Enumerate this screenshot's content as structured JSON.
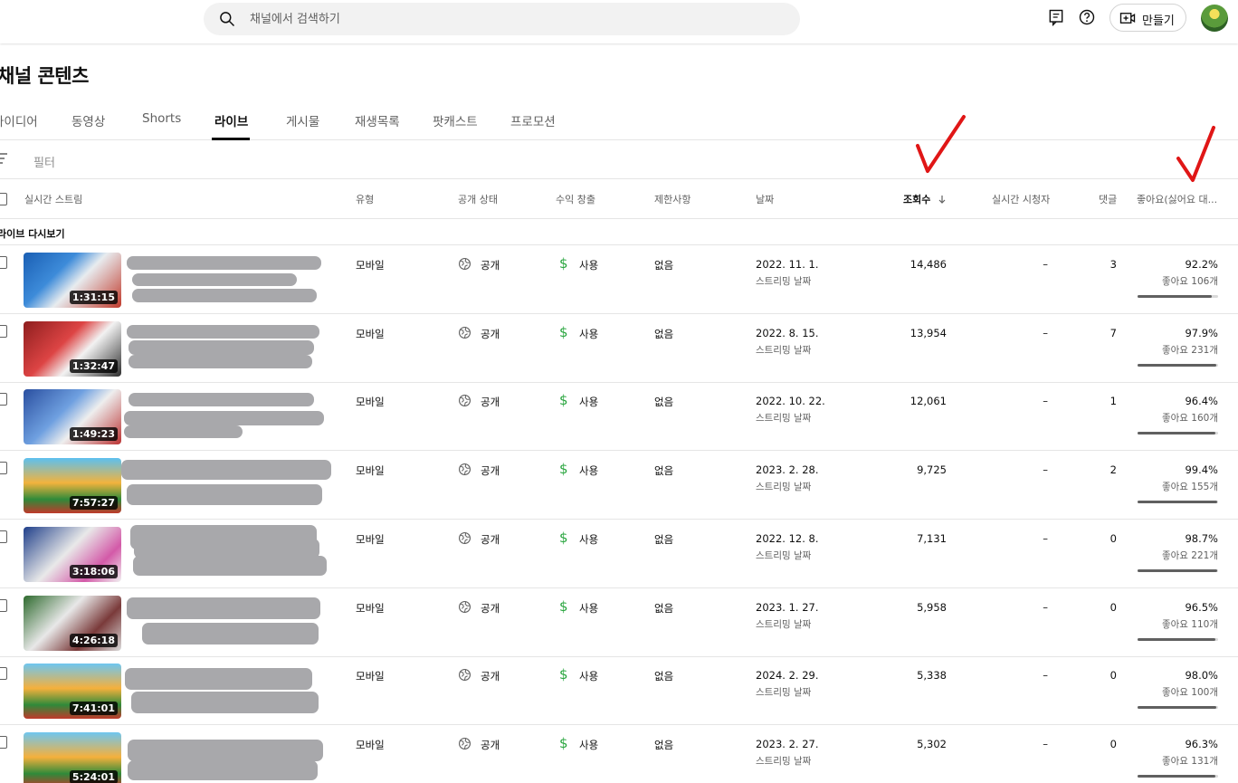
{
  "search": {
    "placeholder": "채널에서 검색하기"
  },
  "topbar": {
    "create_label": "만들기"
  },
  "page_title": "채널 콘텐츠",
  "tabs": [
    {
      "label": "아이디어",
      "active": false
    },
    {
      "label": "동영상",
      "active": false
    },
    {
      "label": "Shorts",
      "active": false
    },
    {
      "label": "라이브",
      "active": true
    },
    {
      "label": "게시물",
      "active": false
    },
    {
      "label": "재생목록",
      "active": false
    },
    {
      "label": "팟캐스트",
      "active": false
    },
    {
      "label": "프로모션",
      "active": false
    }
  ],
  "filter": {
    "label": "필터"
  },
  "columns": {
    "stream": "실시간 스트림",
    "type": "유형",
    "visibility": "공개 상태",
    "monetization": "수익 창출",
    "restrictions": "제한사항",
    "date": "날짜",
    "views": "조회수",
    "live_viewers": "실시간 시청자",
    "comments": "댓글",
    "likes": "좋아요(싫어요 대..."
  },
  "section": {
    "label": "라이브 다시보기"
  },
  "rows": [
    {
      "duration": "1:31:15",
      "type": "모바일",
      "visibility": "공개",
      "monetization": "사용",
      "restrictions": "없음",
      "date": "2022. 11. 1.",
      "date_sub": "스트리밍 날짜",
      "views": "14,486",
      "live_viewers": "–",
      "comments": "3",
      "like_pct": "92.2%",
      "like_count": "좋아요 106개",
      "like_ratio": 0.922
    },
    {
      "duration": "1:32:47",
      "type": "모바일",
      "visibility": "공개",
      "monetization": "사용",
      "restrictions": "없음",
      "date": "2022. 8. 15.",
      "date_sub": "스트리밍 날짜",
      "views": "13,954",
      "live_viewers": "–",
      "comments": "7",
      "like_pct": "97.9%",
      "like_count": "좋아요 231개",
      "like_ratio": 0.979
    },
    {
      "duration": "1:49:23",
      "type": "모바일",
      "visibility": "공개",
      "monetization": "사용",
      "restrictions": "없음",
      "date": "2022. 10. 22.",
      "date_sub": "스트리밍 날짜",
      "views": "12,061",
      "live_viewers": "–",
      "comments": "1",
      "like_pct": "96.4%",
      "like_count": "좋아요 160개",
      "like_ratio": 0.964
    },
    {
      "duration": "7:57:27",
      "type": "모바일",
      "visibility": "공개",
      "monetization": "사용",
      "restrictions": "없음",
      "date": "2023. 2. 28.",
      "date_sub": "스트리밍 날짜",
      "views": "9,725",
      "live_viewers": "–",
      "comments": "2",
      "like_pct": "99.4%",
      "like_count": "좋아요 155개",
      "like_ratio": 0.994
    },
    {
      "duration": "3:18:06",
      "type": "모바일",
      "visibility": "공개",
      "monetization": "사용",
      "restrictions": "없음",
      "date": "2022. 12. 8.",
      "date_sub": "스트리밍 날짜",
      "views": "7,131",
      "live_viewers": "–",
      "comments": "0",
      "like_pct": "98.7%",
      "like_count": "좋아요 221개",
      "like_ratio": 0.987
    },
    {
      "duration": "4:26:18",
      "type": "모바일",
      "visibility": "공개",
      "monetization": "사용",
      "restrictions": "없음",
      "date": "2023. 1. 27.",
      "date_sub": "스트리밍 날짜",
      "views": "5,958",
      "live_viewers": "–",
      "comments": "0",
      "like_pct": "96.5%",
      "like_count": "좋아요 110개",
      "like_ratio": 0.965
    },
    {
      "duration": "7:41:01",
      "type": "모바일",
      "visibility": "공개",
      "monetization": "사용",
      "restrictions": "없음",
      "date": "2024. 2. 29.",
      "date_sub": "스트리밍 날짜",
      "views": "5,338",
      "live_viewers": "–",
      "comments": "0",
      "like_pct": "98.0%",
      "like_count": "좋아요 100개",
      "like_ratio": 0.98
    },
    {
      "duration": "5:24:01",
      "type": "모바일",
      "visibility": "공개",
      "monetization": "사용",
      "restrictions": "없음",
      "date": "2023. 2. 27.",
      "date_sub": "스트리밍 날짜",
      "views": "5,302",
      "live_viewers": "–",
      "comments": "0",
      "like_pct": "96.3%",
      "like_count": "좋아요 131개",
      "like_ratio": 0.963
    }
  ],
  "colors": {
    "monetization_green": "#2ba640",
    "annotation_red": "#e01616"
  }
}
